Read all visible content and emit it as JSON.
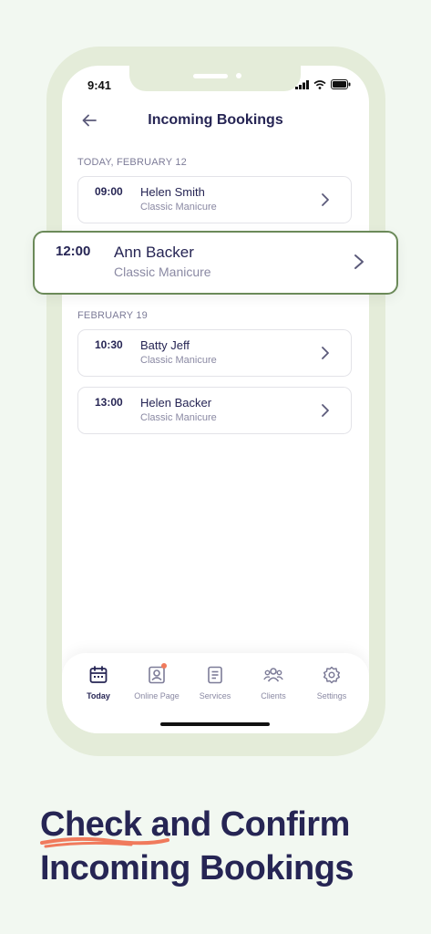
{
  "status_bar": {
    "time": "9:41"
  },
  "header": {
    "title": "Incoming Bookings"
  },
  "sections": [
    {
      "label": "TODAY, FEBRUARY 12",
      "bookings": [
        {
          "time": "09:00",
          "name": "Helen Smith",
          "service": "Classic Manicure"
        },
        {
          "time": "12:00",
          "name": "Ann Backer",
          "service": "Classic Manicure"
        }
      ]
    },
    {
      "label": "FEBRUARY 19",
      "bookings": [
        {
          "time": "10:30",
          "name": "Batty Jeff",
          "service": "Classic Manicure"
        },
        {
          "time": "13:00",
          "name": "Helen Backer",
          "service": "Classic Manicure"
        }
      ]
    }
  ],
  "highlighted_booking": {
    "time": "12:00",
    "name": "Ann Backer",
    "service": "Classic Manicure"
  },
  "tabbar": {
    "items": [
      {
        "label": "Today",
        "icon": "calendar-icon",
        "active": true
      },
      {
        "label": "Online Page",
        "icon": "profile-page-icon",
        "badge": true
      },
      {
        "label": "Services",
        "icon": "document-icon"
      },
      {
        "label": "Clients",
        "icon": "clients-icon"
      },
      {
        "label": "Settings",
        "icon": "gear-icon"
      }
    ]
  },
  "headline": {
    "line1": "Check and Confirm",
    "line2": "Incoming Bookings"
  },
  "colors": {
    "background": "#f2f8f1",
    "frame": "#e4ecd9",
    "primary_text": "#262554",
    "secondary_text": "#8a89a3",
    "highlight_border": "#6b8a59",
    "accent": "#f07a5c"
  }
}
